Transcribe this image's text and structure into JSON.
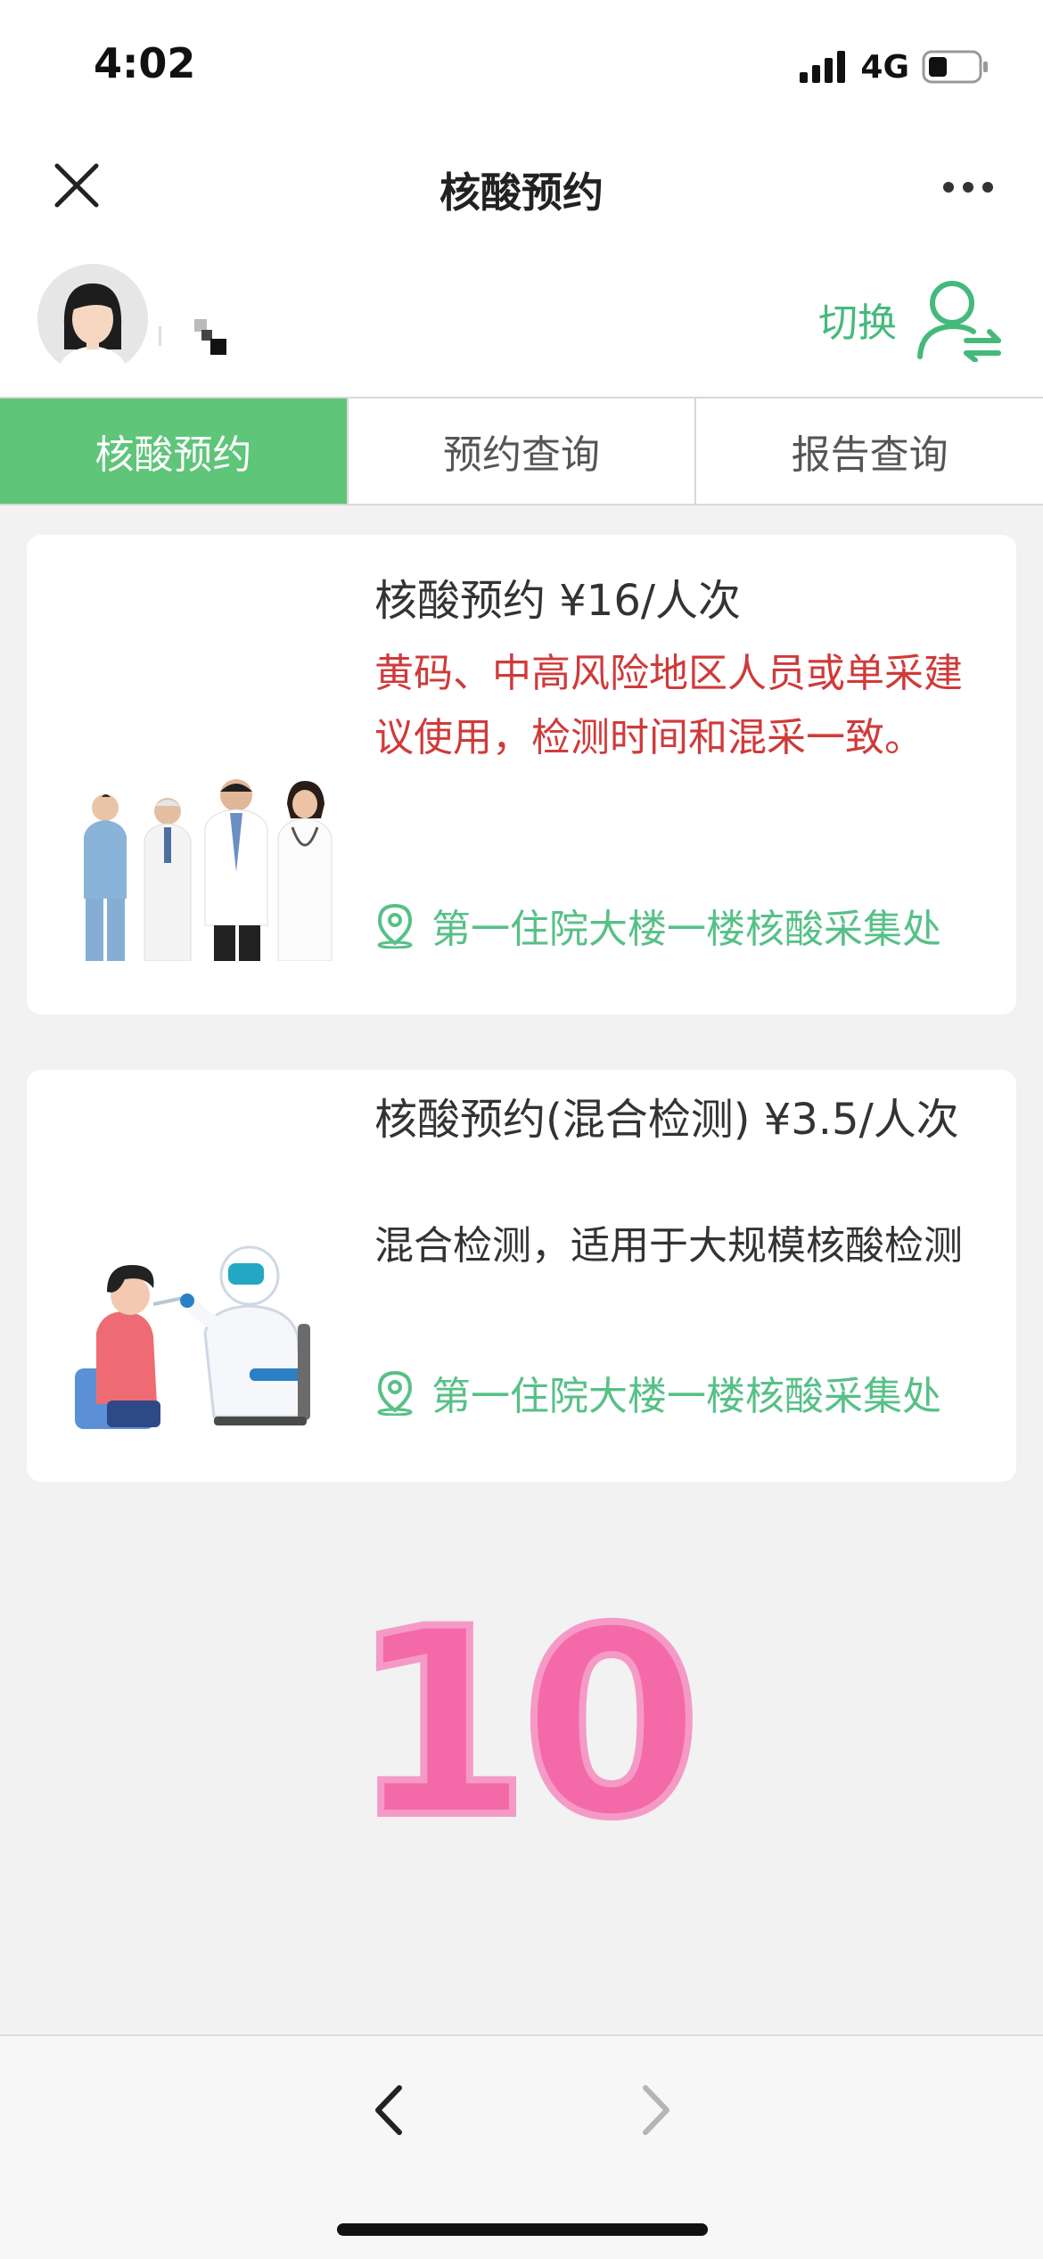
{
  "status_bar": {
    "time": "4:02",
    "network": "4G"
  },
  "nav": {
    "title": "核酸预约"
  },
  "profile": {
    "switch_label": "切换"
  },
  "tabs": [
    {
      "label": "核酸预约",
      "active": true
    },
    {
      "label": "预约查询",
      "active": false
    },
    {
      "label": "报告查询",
      "active": false
    }
  ],
  "cards": [
    {
      "title": "核酸预约 ¥16/人次",
      "description": "黄码、中高风险地区人员或单采建议使用，检测时间和混采一致。",
      "location": "第一住院大楼一楼核酸采集处"
    },
    {
      "title": "核酸预约(混合检测) ¥3.5/人次",
      "description": "混合检测，适用于大规模核酸检测",
      "location": "第一住院大楼一楼核酸采集处"
    }
  ],
  "overlay_number": "10",
  "colors": {
    "accent_green": "#5ec579",
    "warning_red": "#d03a3a",
    "overlay_pink": "#f46aa8"
  }
}
